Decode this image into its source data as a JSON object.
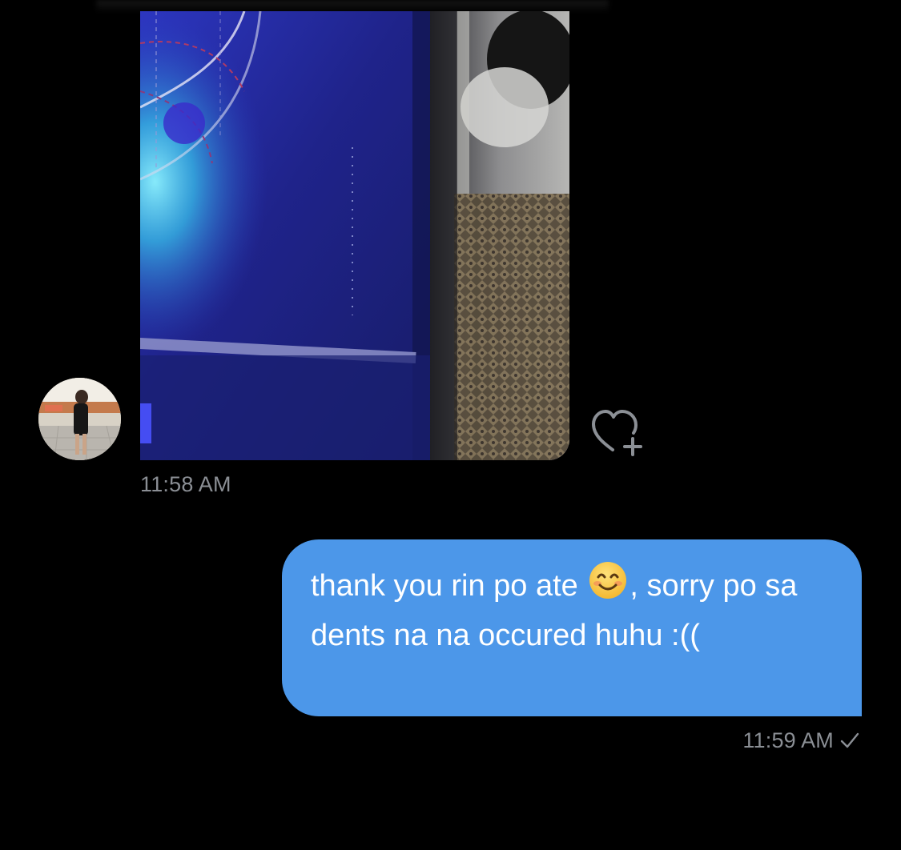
{
  "conversation": {
    "received": {
      "attachment": {
        "kind": "photo",
        "colors": {
          "box_blue": "#22248a",
          "glare_cyan": "#3fd2ff",
          "fabric_gold": "#b39a6c",
          "background_gray": "#8f8f8f"
        }
      },
      "avatar_icon": "avatar-photo",
      "reaction_icon": "heart-plus-icon",
      "time": "11:58 AM"
    },
    "sent": {
      "text_before_emoji": "thank you rin po ate ",
      "emoji": "😊",
      "text_after_emoji": ", sorry po sa dents na na occured huhu :((",
      "time": "11:59 AM",
      "status_icon": "check-icon",
      "bubble_color": "#4c97e9"
    }
  }
}
